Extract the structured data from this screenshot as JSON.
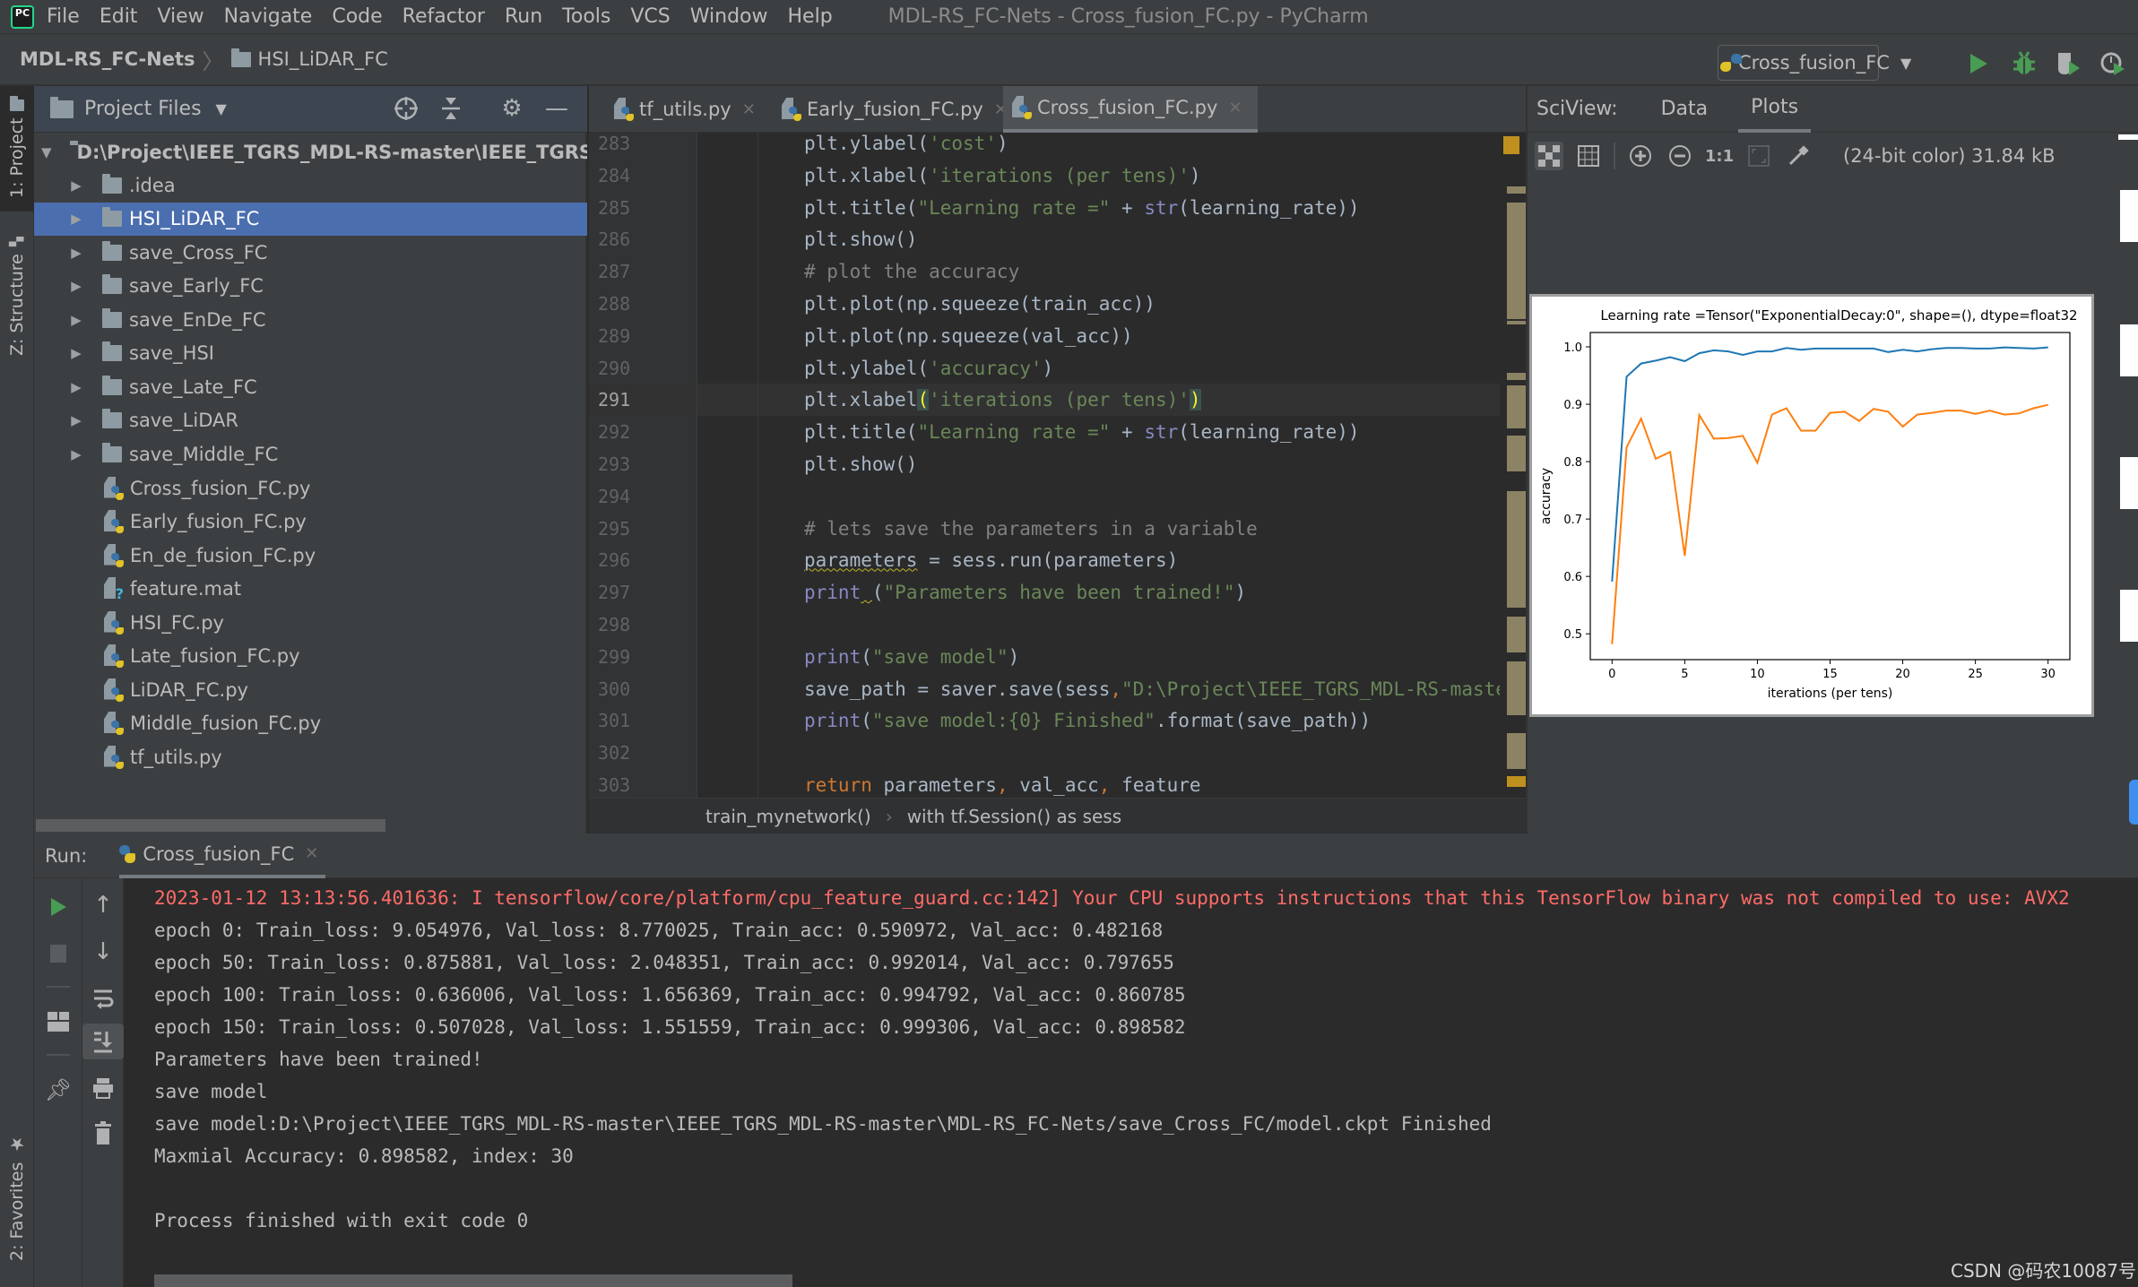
{
  "app": {
    "name": "PyCharm",
    "logo_text": "PC",
    "window_title": "MDL-RS_FC-Nets - Cross_fusion_FC.py - PyCharm"
  },
  "menu": [
    "File",
    "Edit",
    "View",
    "Navigate",
    "Code",
    "Refactor",
    "Run",
    "Tools",
    "VCS",
    "Window",
    "Help"
  ],
  "navbar": {
    "project": "MDL-RS_FC-Nets",
    "folder": "HSI_LiDAR_FC",
    "run_config": "Cross_fusion_FC",
    "buttons": [
      "run",
      "debug",
      "run-with-coverage",
      "profile"
    ]
  },
  "left_strip": {
    "project_tab": "1: Project",
    "structure_tab": "Z: Structure",
    "favorites_tab": "2: Favorites"
  },
  "project_panel": {
    "title": "Project Files",
    "root": "D:\\Project\\IEEE_TGRS_MDL-RS-master\\IEEE_TGRS_MDL-RS-master\\MDL-RS_FC-Nets",
    "folders": [
      ".idea",
      "HSI_LiDAR_FC",
      "save_Cross_FC",
      "save_Early_FC",
      "save_EnDe_FC",
      "save_HSI",
      "save_Late_FC",
      "save_LiDAR",
      "save_Middle_FC"
    ],
    "selected_folder": "HSI_LiDAR_FC",
    "files": [
      {
        "name": "Cross_fusion_FC.py",
        "type": "python"
      },
      {
        "name": "Early_fusion_FC.py",
        "type": "python"
      },
      {
        "name": "En_de_fusion_FC.py",
        "type": "python"
      },
      {
        "name": "feature.mat",
        "type": "unknown"
      },
      {
        "name": "HSI_FC.py",
        "type": "python"
      },
      {
        "name": "Late_fusion_FC.py",
        "type": "python"
      },
      {
        "name": "LiDAR_FC.py",
        "type": "python"
      },
      {
        "name": "Middle_fusion_FC.py",
        "type": "python"
      },
      {
        "name": "tf_utils.py",
        "type": "python"
      }
    ]
  },
  "editor": {
    "tabs": [
      {
        "label": "tf_utils.py",
        "active": false
      },
      {
        "label": "Early_fusion_FC.py",
        "active": false
      },
      {
        "label": "Cross_fusion_FC.py",
        "active": true
      }
    ],
    "current_line": 291,
    "lines": [
      {
        "n": "283",
        "tokens": [
          [
            "",
            "plt.ylabel("
          ],
          [
            "str",
            "'cost'"
          ],
          [
            "",
            ")"
          ]
        ]
      },
      {
        "n": "284",
        "tokens": [
          [
            "",
            "plt.xlabel("
          ],
          [
            "str",
            "'iterations (per tens)'"
          ],
          [
            "",
            ")"
          ]
        ]
      },
      {
        "n": "285",
        "tokens": [
          [
            "",
            "plt.title("
          ],
          [
            "str",
            "\"Learning rate =\""
          ],
          [
            "",
            " + "
          ],
          [
            "bi",
            "str"
          ],
          [
            "",
            "(learning_rate))"
          ]
        ]
      },
      {
        "n": "286",
        "tokens": [
          [
            "",
            "plt.show()"
          ]
        ]
      },
      {
        "n": "287",
        "tokens": [
          [
            "cmt",
            "# plot the accuracy"
          ]
        ]
      },
      {
        "n": "288",
        "tokens": [
          [
            "",
            "plt.plot(np.squeeze(train_acc))"
          ]
        ]
      },
      {
        "n": "289",
        "tokens": [
          [
            "",
            "plt.plot(np.squeeze(val_acc))"
          ]
        ]
      },
      {
        "n": "290",
        "tokens": [
          [
            "",
            "plt.ylabel("
          ],
          [
            "str",
            "'accuracy'"
          ],
          [
            "",
            ")"
          ]
        ]
      },
      {
        "n": "291",
        "tokens": [
          [
            "",
            "plt.xlabel"
          ],
          [
            "brace-hl",
            "("
          ],
          [
            "str",
            "'iterations (per tens)'"
          ],
          [
            "brace-hl",
            ")"
          ]
        ]
      },
      {
        "n": "292",
        "tokens": [
          [
            "",
            "plt.title("
          ],
          [
            "str",
            "\"Learning rate =\""
          ],
          [
            "",
            " + "
          ],
          [
            "bi",
            "str"
          ],
          [
            "",
            "(learning_rate))"
          ]
        ]
      },
      {
        "n": "293",
        "tokens": [
          [
            "",
            "plt.show()"
          ]
        ]
      },
      {
        "n": "294",
        "tokens": []
      },
      {
        "n": "295",
        "tokens": [
          [
            "cmt",
            "# lets save the parameters in a variable"
          ]
        ]
      },
      {
        "n": "296",
        "tokens": [
          [
            "warn",
            "parameters"
          ],
          [
            "",
            " = sess.run(parameters)"
          ]
        ]
      },
      {
        "n": "297",
        "tokens": [
          [
            "bi",
            "print"
          ],
          [
            "warn",
            " "
          ],
          [
            "",
            "("
          ],
          [
            "str",
            "\"Parameters have been trained!\""
          ],
          [
            "",
            ")"
          ]
        ]
      },
      {
        "n": "298",
        "tokens": []
      },
      {
        "n": "299",
        "tokens": [
          [
            "bi",
            "print"
          ],
          [
            "",
            "("
          ],
          [
            "str",
            "\"save model\""
          ],
          [
            "",
            ")"
          ]
        ]
      },
      {
        "n": "300",
        "tokens": [
          [
            "",
            "save_path = saver.save(sess"
          ],
          [
            "kw",
            ","
          ],
          [
            "str",
            "\"D:\\Project\\IEEE_TGRS_MDL-RS-master\\IEEE_TGRS_MDL-RS-master\\MDL-RS_FC-Nets/save_Cross_FC/model.ckpt\""
          ],
          [
            "",
            ")"
          ]
        ]
      },
      {
        "n": "301",
        "tokens": [
          [
            "bi",
            "print"
          ],
          [
            "",
            "("
          ],
          [
            "str",
            "\"save model:{0} Finished\""
          ],
          [
            "",
            ".format(save_path))"
          ]
        ]
      },
      {
        "n": "302",
        "tokens": []
      },
      {
        "n": "303",
        "tokens": [
          [
            "kw",
            "return "
          ],
          [
            "",
            "parameters"
          ],
          [
            "kw",
            ", "
          ],
          [
            "",
            "val_acc"
          ],
          [
            "kw",
            ", "
          ],
          [
            "",
            "feature"
          ]
        ]
      }
    ],
    "breadcrumb": [
      "train_mynetwork()",
      "with tf.Session() as sess"
    ]
  },
  "sciview": {
    "label": "SciView:",
    "tabs": [
      {
        "label": "Data",
        "active": false
      },
      {
        "label": "Plots",
        "active": true
      }
    ],
    "toolbar": [
      "chessboard",
      "grid",
      "zoom-in",
      "zoom-out",
      "1:1",
      "fit",
      "color-picker"
    ],
    "zoom_label": "1:1",
    "image_info": "(24-bit color) 31.84 kB",
    "thumbnail_count": 4
  },
  "chart_data": {
    "type": "line",
    "title": "Learning rate =Tensor(\"ExponentialDecay:0\", shape=(), dtype=float32",
    "xlabel": "iterations (per tens)",
    "ylabel": "accuracy",
    "xlim": [
      -1.5,
      31.5
    ],
    "ylim": [
      0.455,
      1.025
    ],
    "xticks": [
      0,
      5,
      10,
      15,
      20,
      25,
      30
    ],
    "yticks": [
      0.5,
      0.6,
      0.7,
      0.8,
      0.9,
      1.0
    ],
    "ytick_labels": [
      "0.5",
      "0.6",
      "0.7",
      "0.8",
      "0.9",
      "1.0"
    ],
    "grid": false,
    "legend": "none",
    "x": [
      0,
      1,
      2,
      3,
      4,
      5,
      6,
      7,
      8,
      9,
      10,
      11,
      12,
      13,
      14,
      15,
      16,
      17,
      18,
      19,
      20,
      21,
      22,
      23,
      24,
      25,
      26,
      27,
      28,
      29,
      30
    ],
    "series": [
      {
        "name": "train_acc",
        "color": "#1f77b4",
        "values": [
          0.591,
          0.948,
          0.971,
          0.976,
          0.982,
          0.975,
          0.989,
          0.994,
          0.992,
          0.986,
          0.992,
          0.992,
          0.998,
          0.995,
          0.997,
          0.997,
          0.997,
          0.997,
          0.997,
          0.991,
          0.995,
          0.992,
          0.996,
          0.998,
          0.998,
          0.997,
          0.997,
          0.999,
          0.998,
          0.997,
          0.999
        ]
      },
      {
        "name": "val_acc",
        "color": "#ff7f0e",
        "values": [
          0.482,
          0.825,
          0.875,
          0.805,
          0.817,
          0.636,
          0.881,
          0.84,
          0.841,
          0.845,
          0.798,
          0.882,
          0.893,
          0.854,
          0.854,
          0.885,
          0.887,
          0.871,
          0.892,
          0.887,
          0.861,
          0.882,
          0.885,
          0.889,
          0.889,
          0.883,
          0.889,
          0.882,
          0.884,
          0.893,
          0.899
        ]
      }
    ]
  },
  "run_panel": {
    "label": "Run:",
    "tab": "Cross_fusion_FC",
    "console": [
      {
        "text": "2023-01-12 13:13:56.401636: I tensorflow/core/platform/cpu_feature_guard.cc:142] Your CPU supports instructions that this TensorFlow binary was not compiled to use: AVX2",
        "type": "err"
      },
      {
        "text": "epoch 0: Train_loss: 9.054976, Val_loss: 8.770025, Train_acc: 0.590972, Val_acc: 0.482168",
        "type": "out"
      },
      {
        "text": "epoch 50: Train_loss: 0.875881, Val_loss: 2.048351, Train_acc: 0.992014, Val_acc: 0.797655",
        "type": "out"
      },
      {
        "text": "epoch 100: Train_loss: 0.636006, Val_loss: 1.656369, Train_acc: 0.994792, Val_acc: 0.860785",
        "type": "out"
      },
      {
        "text": "epoch 150: Train_loss: 0.507028, Val_loss: 1.551559, Train_acc: 0.999306, Val_acc: 0.898582",
        "type": "out"
      },
      {
        "text": "Parameters have been trained!",
        "type": "out"
      },
      {
        "text": "save model",
        "type": "out"
      },
      {
        "text": "save model:D:\\Project\\IEEE_TGRS_MDL-RS-master\\IEEE_TGRS_MDL-RS-master\\MDL-RS_FC-Nets/save_Cross_FC/model.ckpt Finished",
        "type": "out"
      },
      {
        "text": "Maxmial Accuracy: 0.898582, index: 30",
        "type": "out"
      },
      {
        "text": "",
        "type": "out"
      },
      {
        "text": "Process finished with exit code 0",
        "type": "out"
      }
    ]
  },
  "watermark": "CSDN @码农10087号",
  "colors": {
    "selection": "#4b6eaf",
    "error_text": "#ff6b68",
    "run_green": "#499c54",
    "train_line": "#1f77b4",
    "val_line": "#ff7f0e"
  }
}
